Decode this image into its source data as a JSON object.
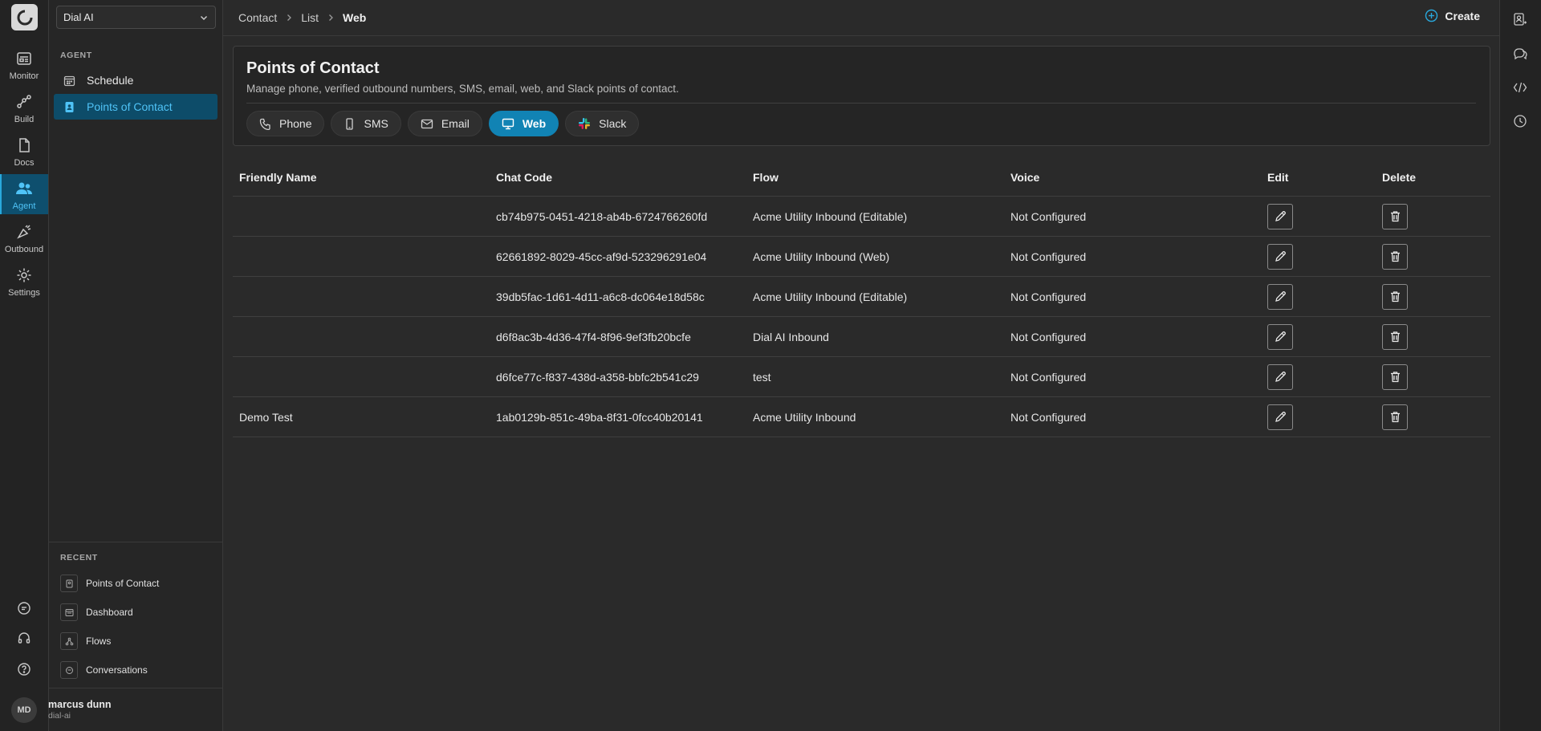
{
  "rail": {
    "items": [
      {
        "label": "Monitor",
        "icon": "monitor-icon"
      },
      {
        "label": "Build",
        "icon": "build-icon"
      },
      {
        "label": "Docs",
        "icon": "docs-icon"
      },
      {
        "label": "Agent",
        "icon": "agent-icon",
        "active": true
      },
      {
        "label": "Outbound",
        "icon": "outbound-icon"
      },
      {
        "label": "Settings",
        "icon": "gear-icon"
      }
    ],
    "avatar_initials": "MD"
  },
  "sidebar": {
    "workspace": "Dial AI",
    "section_label": "AGENT",
    "items": [
      {
        "label": "Schedule",
        "icon": "calendar-icon"
      },
      {
        "label": "Points of Contact",
        "icon": "contact-icon",
        "active": true
      }
    ],
    "recent_label": "RECENT",
    "recent": [
      {
        "label": "Points of Contact",
        "icon": "contact-icon"
      },
      {
        "label": "Dashboard",
        "icon": "dashboard-icon"
      },
      {
        "label": "Flows",
        "icon": "flows-icon"
      },
      {
        "label": "Conversations",
        "icon": "conversations-icon"
      }
    ],
    "user": {
      "name": "marcus dunn",
      "org": "dial-ai"
    }
  },
  "breadcrumb": [
    "Contact",
    "List",
    "Web"
  ],
  "create_label": "Create",
  "card": {
    "title": "Points of Contact",
    "subtitle": "Manage phone, verified outbound numbers, SMS, email, web, and Slack points of contact.",
    "tabs": [
      {
        "label": "Phone",
        "icon": "phone-icon"
      },
      {
        "label": "SMS",
        "icon": "mobile-icon"
      },
      {
        "label": "Email",
        "icon": "mail-icon"
      },
      {
        "label": "Web",
        "icon": "desktop-icon",
        "active": true
      },
      {
        "label": "Slack",
        "icon": "slack-icon"
      }
    ]
  },
  "table": {
    "headers": [
      "Friendly Name",
      "Chat Code",
      "Flow",
      "Voice",
      "Edit",
      "Delete"
    ],
    "rows": [
      {
        "name": "",
        "code": "cb74b975-0451-4218-ab4b-6724766260fd",
        "flow": "Acme Utility Inbound (Editable)",
        "voice": "Not Configured"
      },
      {
        "name": "",
        "code": "62661892-8029-45cc-af9d-523296291e04",
        "flow": "Acme Utility Inbound (Web)",
        "voice": "Not Configured"
      },
      {
        "name": "",
        "code": "39db5fac-1d61-4d11-a6c8-dc064e18d58c",
        "flow": "Acme Utility Inbound (Editable)",
        "voice": "Not Configured"
      },
      {
        "name": "",
        "code": "d6f8ac3b-4d36-47f4-8f96-9ef3fb20bcfe",
        "flow": "Dial AI Inbound",
        "voice": "Not Configured"
      },
      {
        "name": "",
        "code": "d6fce77c-f837-438d-a358-bbfc2b541c29",
        "flow": "test",
        "voice": "Not Configured"
      },
      {
        "name": "Demo Test",
        "code": "1ab0129b-851c-49ba-8f31-0fcc40b20141",
        "flow": "Acme Utility Inbound",
        "voice": "Not Configured"
      }
    ]
  },
  "colors": {
    "accent": "#1183b4",
    "active_bg": "#0d4c69",
    "active_text": "#4fc3f7"
  }
}
